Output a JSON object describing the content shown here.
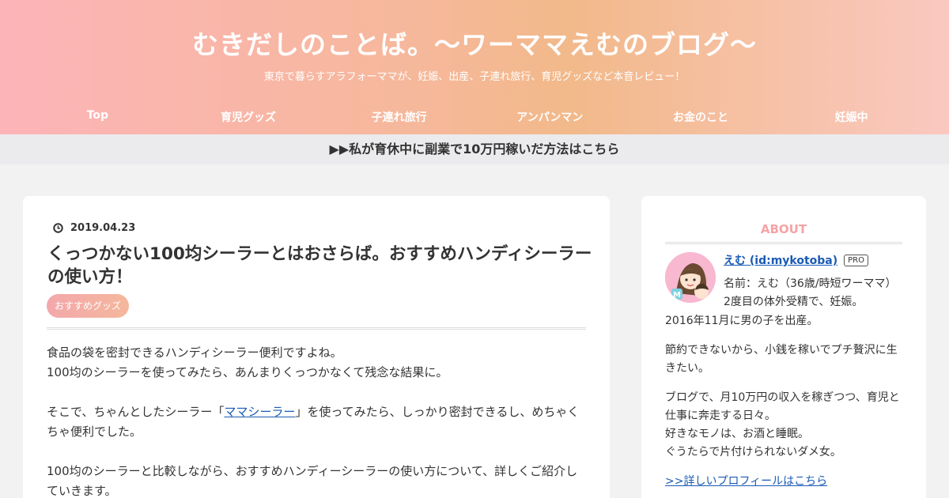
{
  "header": {
    "title": "むきだしのことば。〜ワーママえむのブログ〜",
    "description": "東京で暮らすアラフォーママが、妊娠、出産、子連れ旅行、育児グッズなど本音レビュー！"
  },
  "nav": {
    "items": [
      "Top",
      "育児グッズ",
      "子連れ旅行",
      "アンパンマン",
      "お金のこと",
      "妊娠中"
    ]
  },
  "notice": {
    "text": "▶▶私が育休中に副業で10万円稼いだ方法はこちら"
  },
  "entry": {
    "date": "2019.04.23",
    "title": "くっつかない100均シーラーとはおさらば。おすすめハンディシーラーの使い方！",
    "category": "おすすめグッズ",
    "paragraphs": {
      "p1_line1": "食品の袋を密封できるハンディシーラー便利ですよね。",
      "p1_line2": "100均のシーラーを使ってみたら、あんまりくっつかなくて残念な結果に。",
      "p2_before": "そこで、ちゃんとしたシーラー「",
      "p2_link": "ママシーラー",
      "p2_after": "」を使ってみたら、しっかり密封できるし、めちゃくちゃ便利でした。",
      "p3": "100均のシーラーと比較しながら、おすすめハンディーシーラーの使い方について、詳しくご紹介していきます。"
    }
  },
  "sidebar": {
    "heading": "ABOUT",
    "profile_name": "えむ (id:mykotoba)",
    "pro_label": "PRO",
    "line1": "名前：えむ（36歳/時短ワーママ）",
    "line2": "2度目の体外受精で、妊娠。",
    "line3": "2016年11月に男の子を出産。",
    "para2": "節約できないから、小銭を稼いでプチ贅沢に生きたい。",
    "para3_1": "ブログで、月10万円の収入を稼ぎつつ、育児と仕事に奔走する日々。",
    "para3_2": "好きなモノは、お酒と睡眠。",
    "para3_3": "ぐうたらで片付けられないダメ女。",
    "profile_link": ">>詳しいプロフィールはこちら"
  },
  "colors": {
    "header_gradient_start": "#fcb4b8",
    "header_gradient_end": "#fac8c0",
    "accent_pink": "#f5a3a6",
    "link_blue": "#1a5ab5"
  }
}
